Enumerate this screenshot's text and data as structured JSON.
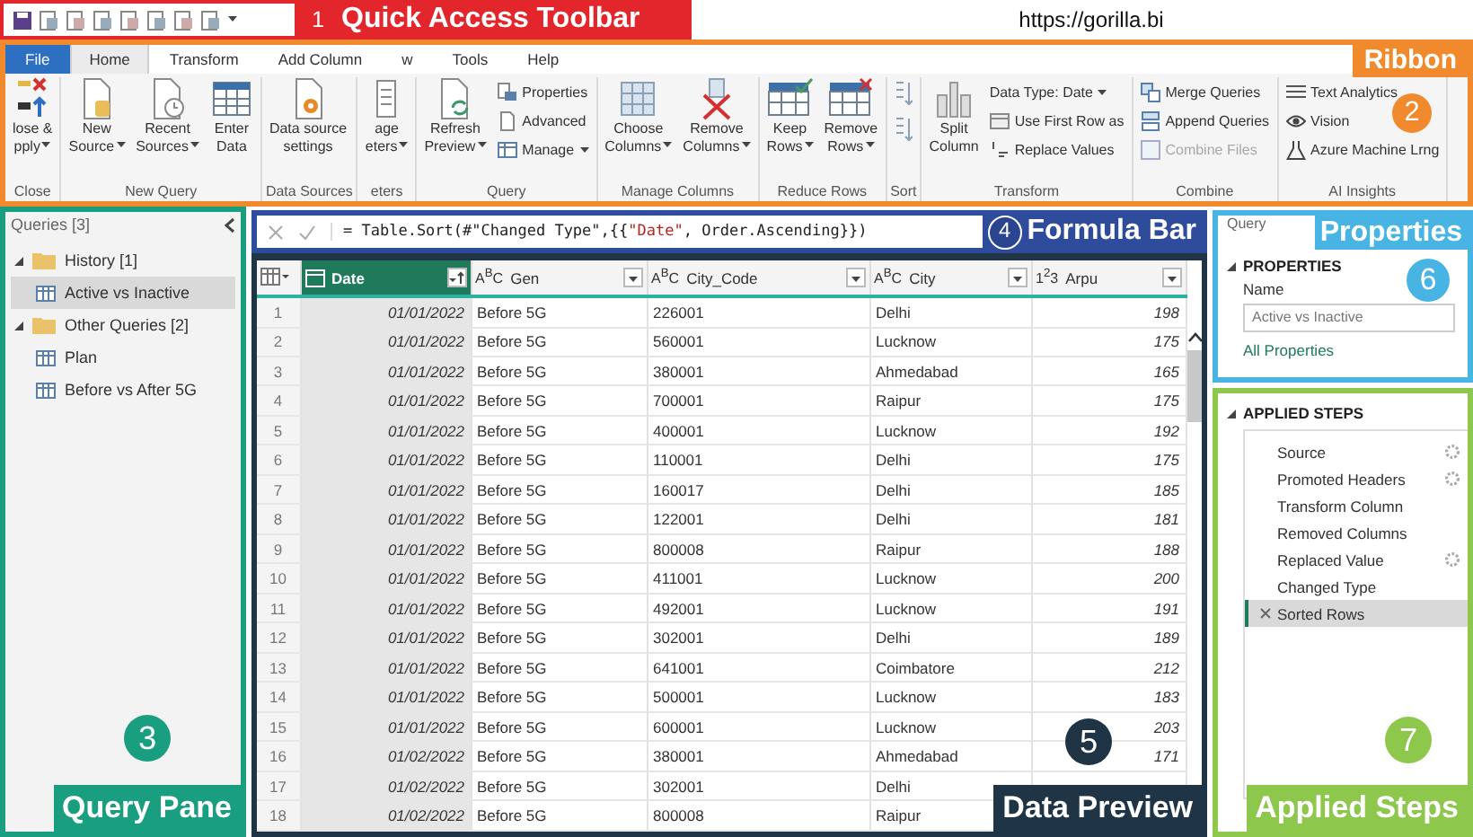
{
  "quick_access_toolbar": {
    "callout": {
      "number": "1",
      "label": "Quick Access Toolbar"
    }
  },
  "url": "https://gorilla.bi",
  "ribbon": {
    "callout": {
      "number": "2",
      "label": "Ribbon"
    },
    "tabs": [
      {
        "label": "File",
        "kind": "file",
        "selected": false
      },
      {
        "label": "Home",
        "kind": "tab",
        "selected": true
      },
      {
        "label": "Transform",
        "kind": "tab",
        "selected": false
      },
      {
        "label": "Add Column",
        "kind": "tab",
        "selected": false
      },
      {
        "label": "w",
        "kind": "tab",
        "selected": false
      },
      {
        "label": "Tools",
        "kind": "tab",
        "selected": false
      },
      {
        "label": "Help",
        "kind": "tab",
        "selected": false
      }
    ],
    "groups": [
      {
        "name": "Close",
        "items": [
          {
            "kind": "large",
            "lines": [
              "lose &",
              "pply"
            ],
            "dropdown": true
          }
        ]
      },
      {
        "name": "New Query",
        "items": [
          {
            "kind": "large",
            "lines": [
              "New",
              "Source"
            ],
            "dropdown": true
          },
          {
            "kind": "large",
            "lines": [
              "Recent",
              "Sources"
            ],
            "dropdown": true
          },
          {
            "kind": "large",
            "lines": [
              "Enter",
              "Data"
            ],
            "dropdown": false
          }
        ]
      },
      {
        "name": "Data Sources",
        "items": [
          {
            "kind": "large",
            "lines": [
              "Data source",
              "settings"
            ],
            "dropdown": false
          }
        ]
      },
      {
        "name": "eters",
        "items": [
          {
            "kind": "large",
            "lines": [
              "age",
              "eters"
            ],
            "dropdown": true
          }
        ]
      },
      {
        "name": "Query",
        "items": [
          {
            "kind": "large",
            "lines": [
              "Refresh",
              "Preview"
            ],
            "dropdown": true
          },
          {
            "kind": "stack",
            "items": [
              {
                "label": "Properties",
                "dropdown": false,
                "disabled": false
              },
              {
                "label": "Advanced",
                "dropdown": false,
                "disabled": false
              },
              {
                "label": "Manage",
                "dropdown": true,
                "disabled": false
              }
            ]
          }
        ]
      },
      {
        "name": "Manage Columns",
        "items": [
          {
            "kind": "large",
            "lines": [
              "Choose",
              "Columns"
            ],
            "dropdown": true
          },
          {
            "kind": "large",
            "lines": [
              "Remove",
              "Columns"
            ],
            "dropdown": true
          }
        ]
      },
      {
        "name": "Reduce Rows",
        "items": [
          {
            "kind": "large",
            "lines": [
              "Keep",
              "Rows"
            ],
            "dropdown": true
          },
          {
            "kind": "large",
            "lines": [
              "Remove",
              "Rows"
            ],
            "dropdown": true
          }
        ]
      },
      {
        "name": "Sort",
        "items": [
          {
            "kind": "icons"
          }
        ]
      },
      {
        "name": "Transform",
        "items": [
          {
            "kind": "large",
            "lines": [
              "Split",
              "Column"
            ],
            "dropdown": false
          },
          {
            "kind": "stack",
            "items": [
              {
                "label": "Data Type: Date",
                "dropdown": true,
                "disabled": false
              },
              {
                "label": "Use First Row as",
                "dropdown": false,
                "disabled": false
              },
              {
                "label": "Replace Values",
                "dropdown": false,
                "disabled": false
              }
            ]
          }
        ]
      },
      {
        "name": "Combine",
        "items": [
          {
            "kind": "stack",
            "items": [
              {
                "label": "Merge Queries",
                "dropdown": false,
                "disabled": false
              },
              {
                "label": "Append Queries",
                "dropdown": false,
                "disabled": false
              },
              {
                "label": "Combine Files",
                "dropdown": false,
                "disabled": true
              }
            ]
          }
        ]
      },
      {
        "name": "AI Insights",
        "items": [
          {
            "kind": "stack",
            "items": [
              {
                "label": "Text Analytics",
                "dropdown": false,
                "disabled": false
              },
              {
                "label": "Vision",
                "dropdown": false,
                "disabled": false
              },
              {
                "label": "Azure Machine Lrng",
                "dropdown": false,
                "disabled": false
              }
            ]
          }
        ]
      }
    ]
  },
  "query_pane": {
    "title": "Queries [3]",
    "callout": {
      "number": "3",
      "label": "Query Pane"
    },
    "tree": [
      {
        "label": "History [1]",
        "expanded": true,
        "selected": false,
        "children": [
          {
            "label": "Active vs Inactive",
            "selected": true
          }
        ]
      },
      {
        "label": "Other Queries [2]",
        "expanded": true,
        "selected": false,
        "children": [
          {
            "label": "Plan",
            "selected": false
          },
          {
            "label": "Before vs After 5G",
            "selected": false
          }
        ]
      }
    ]
  },
  "formula_bar": {
    "callout": {
      "number": "4",
      "label": "Formula Bar"
    },
    "formula": [
      {
        "text": "= Table.Sort(#\"Changed Type\",{{",
        "kind": "code"
      },
      {
        "text": "\"Date\"",
        "kind": "string"
      },
      {
        "text": ", Order.Ascending}})",
        "kind": "code"
      }
    ]
  },
  "data_preview": {
    "callout": {
      "number": "5",
      "label": "Data Preview"
    },
    "columns": [
      {
        "name": "Date",
        "kind": "date",
        "selected": true,
        "sorted": true
      },
      {
        "name": "Gen",
        "kind": "text",
        "type_label": "A$^{B}$C",
        "selected": false,
        "sorted": false
      },
      {
        "name": "City_Code",
        "kind": "text",
        "type_label": "A$^{B}$C",
        "selected": false,
        "sorted": false
      },
      {
        "name": "City",
        "kind": "text",
        "type_label": "A$^{B}$C",
        "selected": false,
        "sorted": false
      },
      {
        "name": "Arpu",
        "kind": "number",
        "type_label": "1$^{2}$3",
        "selected": false,
        "sorted": false
      }
    ],
    "rows": [
      {
        "number": "1",
        "cells": [
          "01/01/2022",
          "Before 5G",
          "226001",
          "Delhi",
          "198"
        ]
      },
      {
        "number": "2",
        "cells": [
          "01/01/2022",
          "Before 5G",
          "560001",
          "Lucknow",
          "175"
        ]
      },
      {
        "number": "3",
        "cells": [
          "01/01/2022",
          "Before 5G",
          "380001",
          "Ahmedabad",
          "165"
        ]
      },
      {
        "number": "4",
        "cells": [
          "01/01/2022",
          "Before 5G",
          "700001",
          "Raipur",
          "175"
        ]
      },
      {
        "number": "5",
        "cells": [
          "01/01/2022",
          "Before 5G",
          "400001",
          "Lucknow",
          "192"
        ]
      },
      {
        "number": "6",
        "cells": [
          "01/01/2022",
          "Before 5G",
          "110001",
          "Delhi",
          "175"
        ]
      },
      {
        "number": "7",
        "cells": [
          "01/01/2022",
          "Before 5G",
          "160017",
          "Delhi",
          "185"
        ]
      },
      {
        "number": "8",
        "cells": [
          "01/01/2022",
          "Before 5G",
          "122001",
          "Delhi",
          "181"
        ]
      },
      {
        "number": "9",
        "cells": [
          "01/01/2022",
          "Before 5G",
          "800008",
          "Raipur",
          "188"
        ]
      },
      {
        "number": "10",
        "cells": [
          "01/01/2022",
          "Before 5G",
          "411001",
          "Lucknow",
          "200"
        ]
      },
      {
        "number": "11",
        "cells": [
          "01/01/2022",
          "Before 5G",
          "492001",
          "Lucknow",
          "191"
        ]
      },
      {
        "number": "12",
        "cells": [
          "01/01/2022",
          "Before 5G",
          "302001",
          "Delhi",
          "189"
        ]
      },
      {
        "number": "13",
        "cells": [
          "01/01/2022",
          "Before 5G",
          "641001",
          "Coimbatore",
          "212"
        ]
      },
      {
        "number": "14",
        "cells": [
          "01/01/2022",
          "Before 5G",
          "500001",
          "Lucknow",
          "183"
        ]
      },
      {
        "number": "15",
        "cells": [
          "01/01/2022",
          "Before 5G",
          "600001",
          "Lucknow",
          "203"
        ]
      },
      {
        "number": "16",
        "cells": [
          "01/02/2022",
          "Before 5G",
          "380001",
          "Ahmedabad",
          "171"
        ]
      },
      {
        "number": "17",
        "cells": [
          "01/02/2022",
          "Before 5G",
          "302001",
          "Delhi"
        ]
      },
      {
        "number": "18",
        "cells": [
          "01/02/2022",
          "Before 5G",
          "800008",
          "Raipur"
        ]
      }
    ]
  },
  "query_settings": {
    "title": "Query",
    "callout": {
      "number": "6",
      "label": "Properties"
    },
    "properties": {
      "heading": "PROPERTIES",
      "expanded": true,
      "name_label": "Name",
      "name_value": "Active vs Inactive",
      "link": "All Properties"
    }
  },
  "applied_steps": {
    "heading": "APPLIED STEPS",
    "expanded": true,
    "callout": {
      "number": "7",
      "label": "Applied Steps"
    },
    "steps": [
      {
        "name": "Source",
        "settings": true,
        "selected": false
      },
      {
        "name": "Promoted Headers",
        "settings": true,
        "selected": false
      },
      {
        "name": "Transform Column",
        "settings": false,
        "selected": false
      },
      {
        "name": "Removed Columns",
        "settings": false,
        "selected": false
      },
      {
        "name": "Replaced Value",
        "settings": true,
        "selected": false
      },
      {
        "name": "Changed Type",
        "settings": false,
        "selected": false
      },
      {
        "name": "Sorted Rows",
        "settings": false,
        "selected": true
      }
    ]
  }
}
